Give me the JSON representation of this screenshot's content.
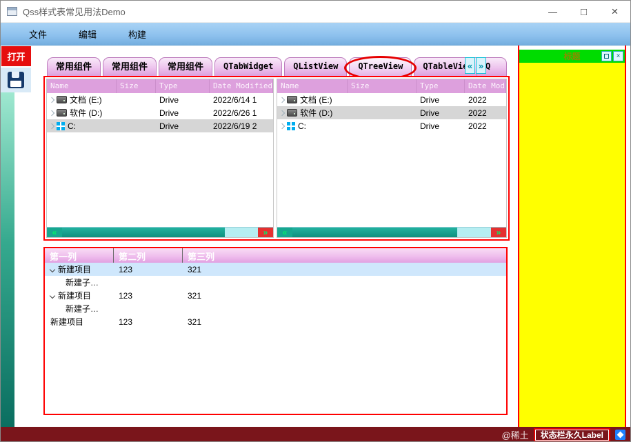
{
  "window": {
    "title": "Qss样式表常见用法Demo"
  },
  "titlebar_controls": {
    "minimize": "—",
    "maximize": "□",
    "close": "×"
  },
  "menubar": {
    "items": [
      "文件",
      "编辑",
      "构建"
    ]
  },
  "sidebar": {
    "open_label": "打开"
  },
  "icons": {
    "scroll_left": "«",
    "scroll_right": "»",
    "save": "floppy-icon",
    "branch_collapsed": "chevron-right",
    "branch_expanded": "chevron-down",
    "drive": "drive-icon",
    "c_drive": "windows-logo-icon"
  },
  "tabbar": {
    "tabs": [
      "常用组件",
      "常用组件",
      "常用组件",
      "QTabWidget",
      "QListView",
      "QTreeView",
      "QTableView",
      "Q"
    ]
  },
  "tree1": {
    "headers": [
      "Name",
      "Size",
      "Type",
      "Date Modified"
    ],
    "rows": [
      {
        "name": "文档 (E:)",
        "size": "",
        "type": "Drive",
        "date": "2022/6/14 1"
      },
      {
        "name": "软件 (D:)",
        "size": "",
        "type": "Drive",
        "date": "2022/6/26 1"
      },
      {
        "name": "C:",
        "size": "",
        "type": "Drive",
        "date": "2022/6/19 2"
      }
    ]
  },
  "tree2": {
    "headers": [
      "Name",
      "Size",
      "Type",
      "Date Modified"
    ],
    "rows": [
      {
        "name": "文档 (E:)",
        "size": "",
        "type": "Drive",
        "date": "2022"
      },
      {
        "name": "软件 (D:)",
        "size": "",
        "type": "Drive",
        "date": "2022"
      },
      {
        "name": "C:",
        "size": "",
        "type": "Drive",
        "date": "2022"
      }
    ]
  },
  "lower_tree": {
    "headers": [
      "第一列",
      "第二列",
      "第三列"
    ],
    "rows": [
      {
        "col1": "新建项目",
        "col2": "123",
        "col3": "321"
      },
      {
        "col1": "新建子…",
        "col2": "",
        "col3": ""
      },
      {
        "col1": "新建项目",
        "col2": "123",
        "col3": "321"
      },
      {
        "col1": "新建子…",
        "col2": "",
        "col3": ""
      },
      {
        "col1": "新建项目",
        "col2": "123",
        "col3": "321"
      }
    ]
  },
  "dock": {
    "title": "标题",
    "close_glyph": "×"
  },
  "statusbar": {
    "watermark": "@稀土",
    "permanent_label": "状态栏永久Label"
  },
  "colors": {
    "accent_red": "#ff0000",
    "tab_violet": "#dda0dd",
    "menubar_blue": "#8fc2ee",
    "open_button_red": "#e60e0e",
    "scrollbar_teal": "#17a78f",
    "scrollbar_button_red": "#e53030",
    "dock_yellow": "#ffff00",
    "dock_title_green": "#00dc00",
    "statusbar_maroon": "#7a151b",
    "selection_gray": "#d6d6d6",
    "selection_blue": "#cfe7fc"
  }
}
